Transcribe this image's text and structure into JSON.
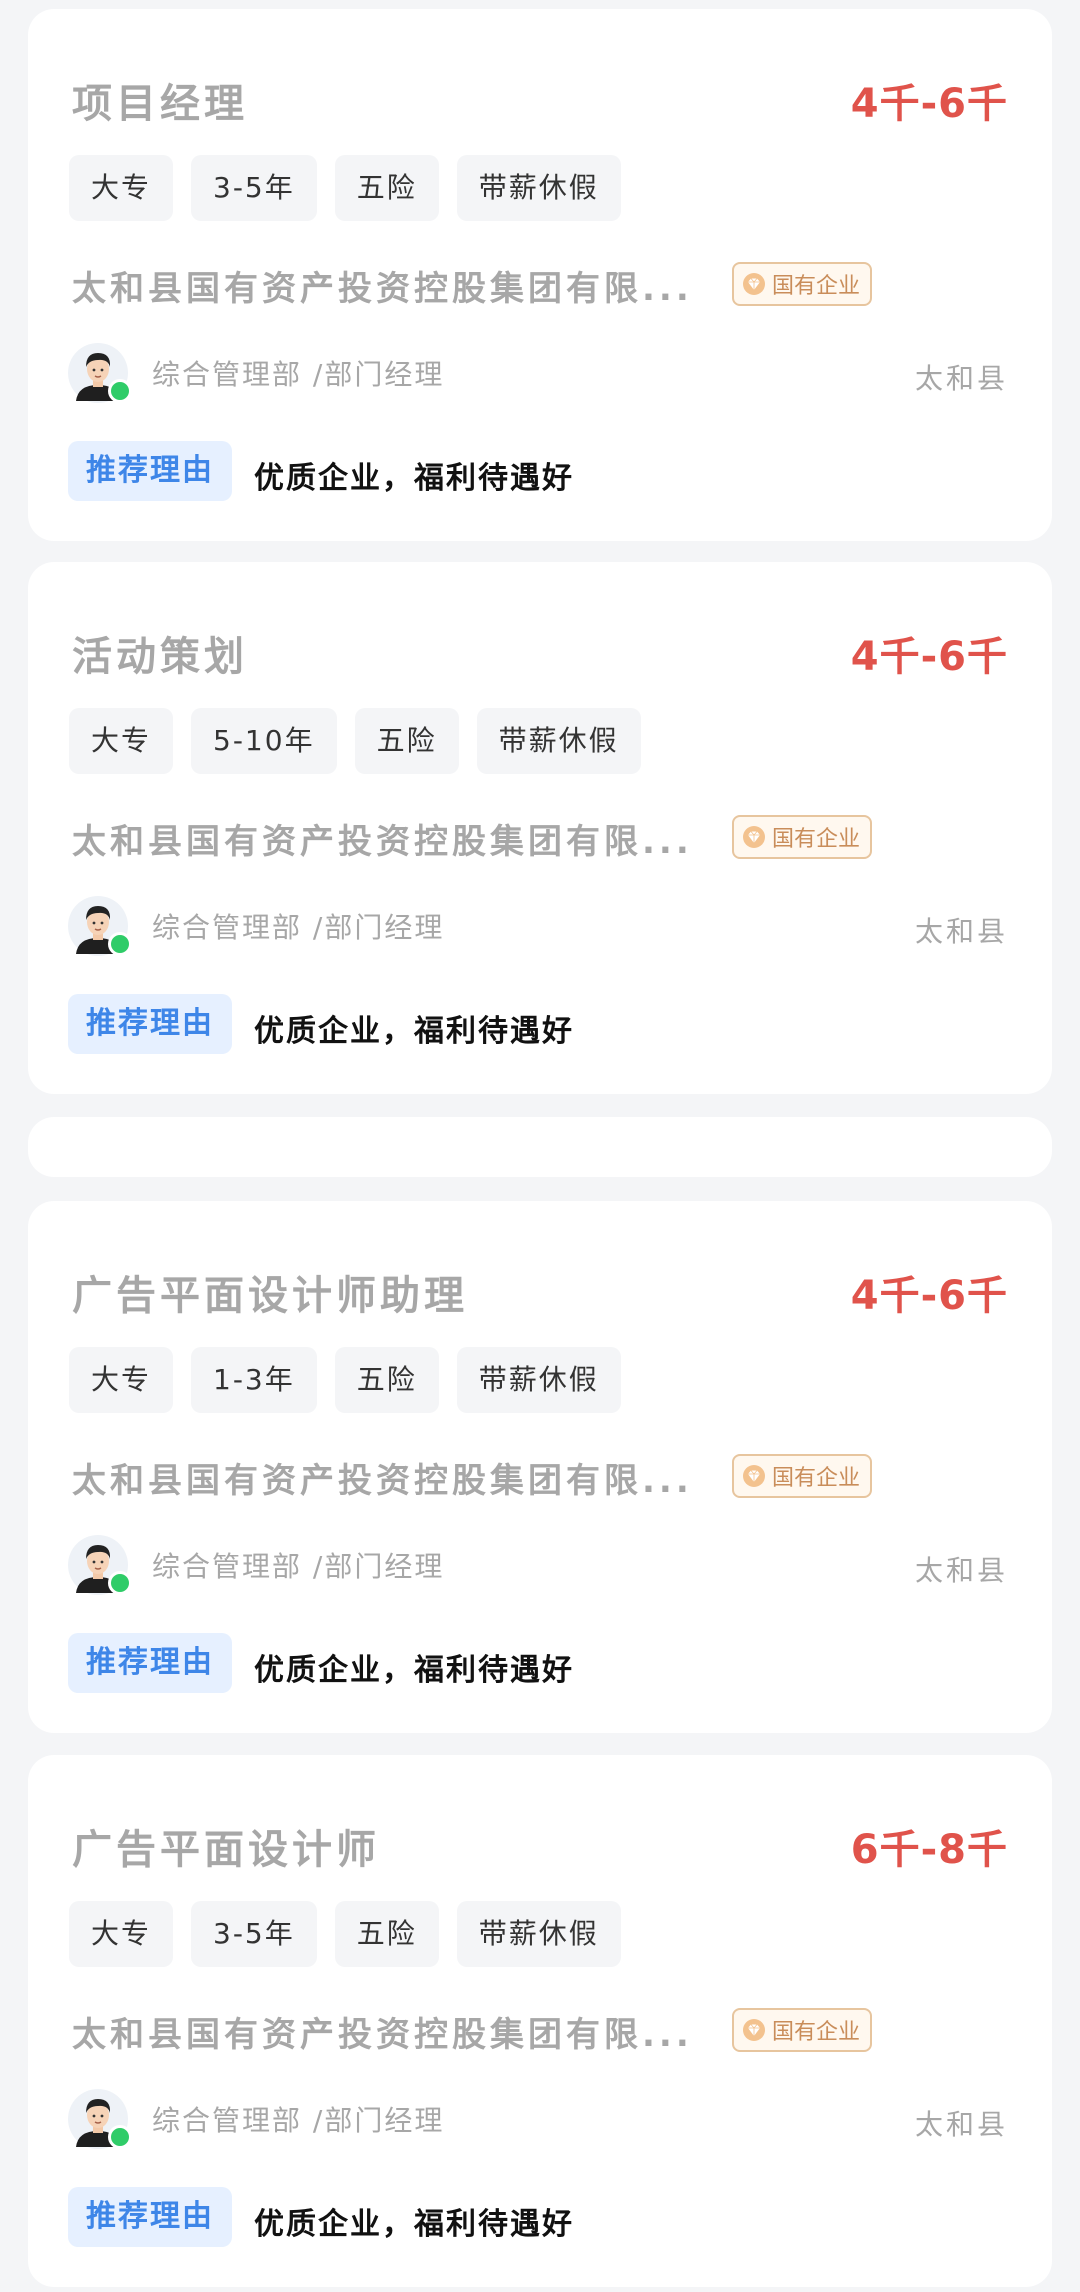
{
  "jobs": [
    {
      "title": "项目经理",
      "salary": "4千-6千",
      "tags": [
        "大专",
        "3-5年",
        "五险",
        "带薪休假"
      ],
      "company": "太和县国有资产投资控股集团有限...",
      "badge": "国有企业",
      "recruiter": "综合管理部 /部门经理",
      "location": "太和县",
      "reason_label": "推荐理由",
      "reason": "优质企业，福利待遇好"
    },
    {
      "title": "活动策划",
      "salary": "4千-6千",
      "tags": [
        "大专",
        "5-10年",
        "五险",
        "带薪休假"
      ],
      "company": "太和县国有资产投资控股集团有限...",
      "badge": "国有企业",
      "recruiter": "综合管理部 /部门经理",
      "location": "太和县",
      "reason_label": "推荐理由",
      "reason": "优质企业，福利待遇好"
    },
    {
      "title": "广告平面设计师助理",
      "salary": "4千-6千",
      "tags": [
        "大专",
        "1-3年",
        "五险",
        "带薪休假"
      ],
      "company": "太和县国有资产投资控股集团有限...",
      "badge": "国有企业",
      "recruiter": "综合管理部 /部门经理",
      "location": "太和县",
      "reason_label": "推荐理由",
      "reason": "优质企业，福利待遇好"
    },
    {
      "title": "广告平面设计师",
      "salary": "6千-8千",
      "tags": [
        "大专",
        "3-5年",
        "五险",
        "带薪休假"
      ],
      "company": "太和县国有资产投资控股集团有限...",
      "badge": "国有企业",
      "recruiter": "综合管理部 /部门经理",
      "location": "太和县",
      "reason_label": "推荐理由",
      "reason": "优质企业，福利待遇好"
    }
  ],
  "icons": {
    "badge_icon": "diamond-icon",
    "avatar_icon": "recruiter-avatar"
  },
  "colors": {
    "salary": "#e0534b",
    "reason_accent": "#3e86e8",
    "badge": "#c98d5a",
    "online": "#2fcc68"
  }
}
